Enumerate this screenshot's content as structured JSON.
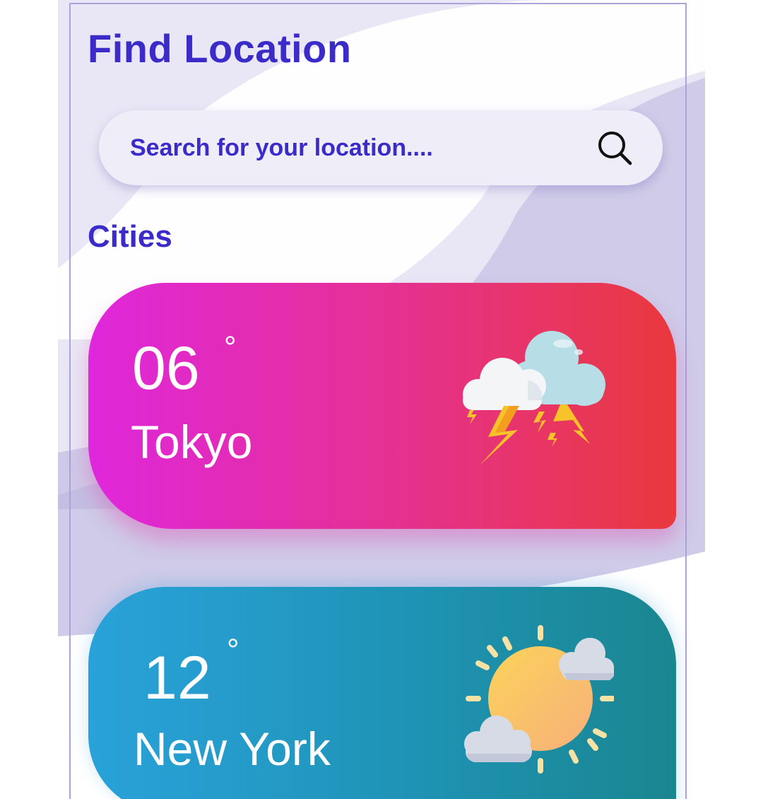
{
  "header": {
    "title": "Find Location"
  },
  "search": {
    "placeholder": "Search for your location....",
    "icon": "search-icon"
  },
  "cities_section": {
    "title": "Cities",
    "items": [
      {
        "temperature": "06",
        "degree_symbol": "°",
        "city": "Tokyo",
        "icon": "thunderstorm-icon",
        "gradient": [
          "#df27dc",
          "#e6318c",
          "#e9393c"
        ]
      },
      {
        "temperature": "12",
        "degree_symbol": "°",
        "city": "New York",
        "icon": "partly-sunny-icon",
        "gradient": [
          "#29a2da",
          "#1f93b5",
          "#1a8690"
        ]
      }
    ]
  },
  "colors": {
    "accent": "#3b2bc9",
    "background": "#e8e6f4",
    "search_bg": "#eeedf8"
  }
}
